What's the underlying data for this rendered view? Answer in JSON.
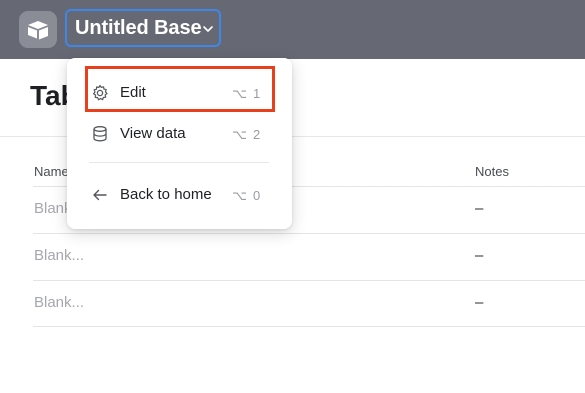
{
  "header": {
    "base_title": "Untitled Base"
  },
  "page": {
    "title": "Table"
  },
  "table": {
    "columns": [
      "Name",
      "Notes"
    ],
    "rows": [
      {
        "name": "Blank...",
        "notes": "–"
      },
      {
        "name": "Blank...",
        "notes": "–"
      },
      {
        "name": "Blank...",
        "notes": "–"
      }
    ]
  },
  "menu": {
    "items": [
      {
        "label": "Edit",
        "icon": "gear-icon",
        "shortcut_symbol": "⌥",
        "shortcut_key": "1"
      },
      {
        "label": "View data",
        "icon": "database-icon",
        "shortcut_symbol": "⌥",
        "shortcut_key": "2"
      },
      {
        "label": "Back to home",
        "icon": "arrow-left-icon",
        "shortcut_symbol": "⌥",
        "shortcut_key": "0"
      }
    ]
  },
  "colors": {
    "topbar": "#666973",
    "focus_ring": "#3f86e8",
    "highlight": "#e8401c"
  }
}
